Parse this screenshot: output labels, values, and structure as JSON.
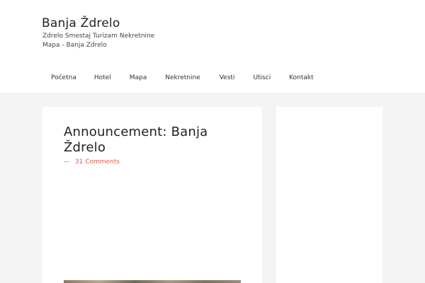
{
  "site": {
    "title": "Banja Ždrelo",
    "tagline": "Zdrelo Smestaj Turizam Nekretnine Mapa - Banja Zdrelo"
  },
  "nav": {
    "items": [
      {
        "label": "Početna"
      },
      {
        "label": "Hotel"
      },
      {
        "label": "Mapa"
      },
      {
        "label": "Nekretnine"
      },
      {
        "label": "Vesti"
      },
      {
        "label": "Utisci"
      },
      {
        "label": "Kontakt"
      }
    ]
  },
  "post": {
    "title": "Announcement: Banja Ždrelo",
    "meta_dash": "—",
    "comments_label": "31 Comments"
  },
  "colors": {
    "accent": "#e25c4b",
    "page_background": "#f4f4f4",
    "panel_background": "#ffffff"
  }
}
